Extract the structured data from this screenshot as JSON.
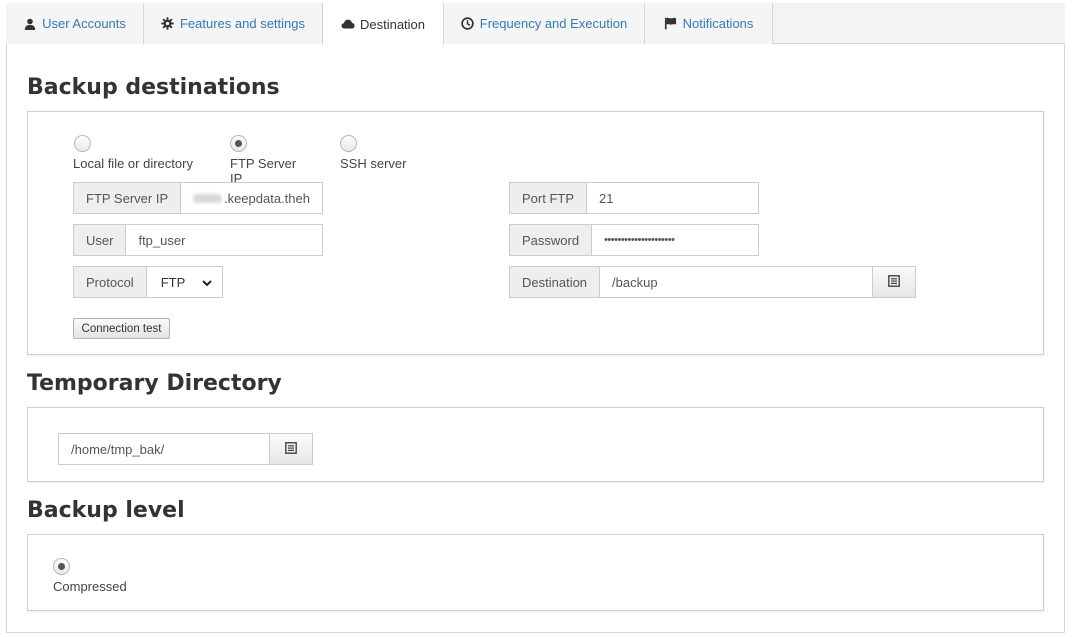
{
  "tabs": [
    {
      "label": "User Accounts",
      "icon": "user-icon"
    },
    {
      "label": "Features and settings",
      "icon": "gear-icon"
    },
    {
      "label": "Destination",
      "icon": "cloud-icon"
    },
    {
      "label": "Frequency and Execution",
      "icon": "clock-icon"
    },
    {
      "label": "Notifications",
      "icon": "flag-icon"
    }
  ],
  "active_tab": "Destination",
  "backup_destinations": {
    "title": "Backup destinations",
    "radio_options": [
      {
        "label": "Local file or directory",
        "checked": false
      },
      {
        "label": "FTP Server IP",
        "checked": true
      },
      {
        "label": "SSH server",
        "checked": false
      }
    ],
    "ftp_server": {
      "label": "FTP Server IP",
      "value": ".keepdata.theh"
    },
    "port": {
      "label": "Port FTP",
      "value": "21"
    },
    "user": {
      "label": "User",
      "value": "ftp_user"
    },
    "password": {
      "label": "Password",
      "value": "•••••••••••••••••••••"
    },
    "protocol": {
      "label": "Protocol",
      "value": "FTP"
    },
    "destination": {
      "label": "Destination",
      "value": "/backup"
    },
    "connection_test_label": "Connection test"
  },
  "temporary_directory": {
    "title": "Temporary Directory",
    "value": "/home/tmp_bak/"
  },
  "backup_level": {
    "title": "Backup level",
    "option": {
      "label": "Compressed",
      "checked": true
    }
  }
}
